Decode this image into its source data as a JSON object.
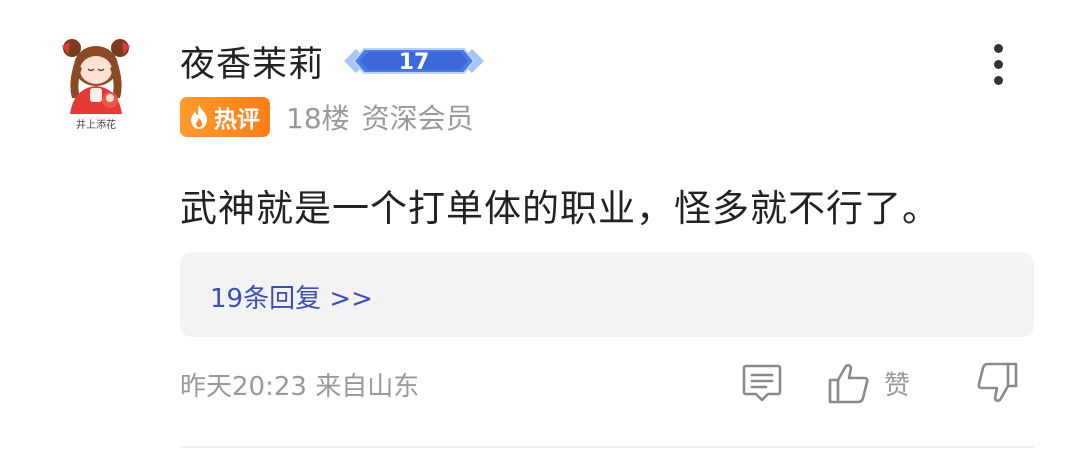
{
  "comment": {
    "username": "夜香茉莉",
    "level_badge": "17",
    "avatar_caption": "井上添花",
    "hot_label": "热评",
    "floor": "18楼",
    "member_type": "资深会员",
    "text": "武神就是一个打单体的职业，怪多就不行了。",
    "replies_link": "19条回复 >>",
    "timestamp_location": "昨天20:23 来自山东",
    "like_label": "赞"
  },
  "icons": [
    "more-vertical-icon",
    "flame-icon",
    "comment-icon",
    "thumbs-up-icon",
    "thumbs-down-icon"
  ],
  "colors": {
    "hot_badge": "#ff8a22",
    "reply_link": "#3d4fb4",
    "reply_box_bg": "#f3f3f5",
    "secondary_text": "#999999",
    "level_badge": "#4a7be8"
  }
}
